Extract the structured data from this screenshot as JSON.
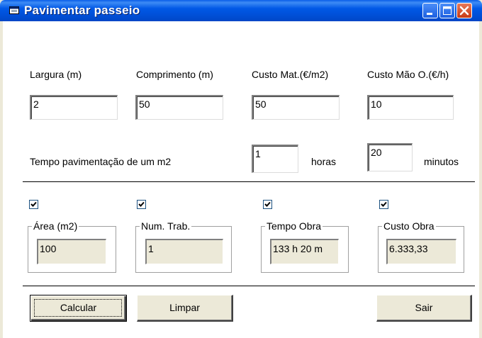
{
  "window": {
    "title": "Pavimentar passeio"
  },
  "inputs": {
    "largura": {
      "label": "Largura (m)",
      "value": "2"
    },
    "comprimento": {
      "label": "Comprimento (m)",
      "value": "50"
    },
    "custo_mat": {
      "label": "Custo Mat.(€/m2)",
      "value": "50"
    },
    "custo_mao": {
      "label": "Custo Mão O.(€/h)",
      "value": "10"
    }
  },
  "tempo": {
    "label": "Tempo pavimentação de um m2",
    "horas_value": "1",
    "horas_label": "horas",
    "minutos_value": "20",
    "minutos_label": "minutos"
  },
  "results": {
    "area": {
      "label": "Área (m2)",
      "value": "100",
      "checked": true
    },
    "num_trab": {
      "label": "Num. Trab.",
      "value": "1",
      "checked": true
    },
    "tempo_obra": {
      "label": "Tempo Obra",
      "value": "133 h 20 m",
      "checked": true
    },
    "custo_obra": {
      "label": "Custo Obra",
      "value": "6.333,33",
      "checked": true
    }
  },
  "buttons": {
    "calcular": "Calcular",
    "limpar": "Limpar",
    "sair": "Sair"
  }
}
